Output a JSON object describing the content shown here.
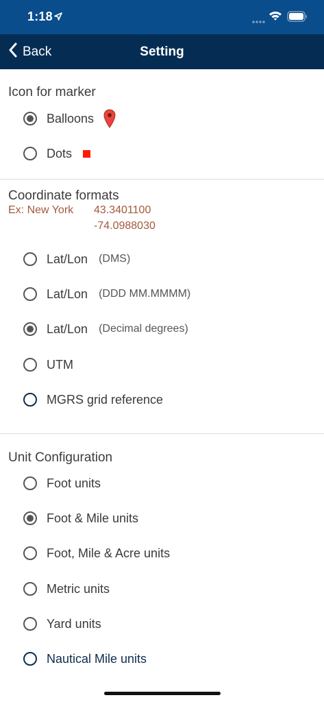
{
  "status_bar": {
    "time": "1:18"
  },
  "nav": {
    "back_label": "Back",
    "title": "Setting"
  },
  "marker_section": {
    "title": "Icon for marker",
    "options": [
      {
        "label": "Balloons",
        "selected": true
      },
      {
        "label": "Dots",
        "selected": false
      }
    ]
  },
  "coordinate_section": {
    "title": "Coordinate formats",
    "example_label": "Ex: New York",
    "example_lat": "43.3401100",
    "example_lon": "-74.0988030",
    "options": [
      {
        "label": "Lat/Lon",
        "sub": "(DMS)",
        "selected": false
      },
      {
        "label": "Lat/Lon",
        "sub": "(DDD MM.MMMM)",
        "selected": false
      },
      {
        "label": "Lat/Lon",
        "sub": "(Decimal degrees)",
        "selected": true
      },
      {
        "label": "UTM",
        "selected": false
      },
      {
        "label": "MGRS grid reference",
        "selected": false
      }
    ]
  },
  "unit_section": {
    "title": "Unit Configuration",
    "options": [
      {
        "label": "Foot units",
        "selected": false
      },
      {
        "label": "Foot & Mile units",
        "selected": true
      },
      {
        "label": "Foot, Mile & Acre units",
        "selected": false
      },
      {
        "label": "Metric units",
        "selected": false
      },
      {
        "label": "Yard units",
        "selected": false
      },
      {
        "label": "Nautical Mile units",
        "selected": false
      }
    ]
  },
  "colors": {
    "status_bar": "#0a4d8c",
    "nav_bar": "#052d54",
    "example_text": "#a35a3c",
    "dots_marker": "#ff1a00",
    "balloon_marker": "#e8453c"
  }
}
